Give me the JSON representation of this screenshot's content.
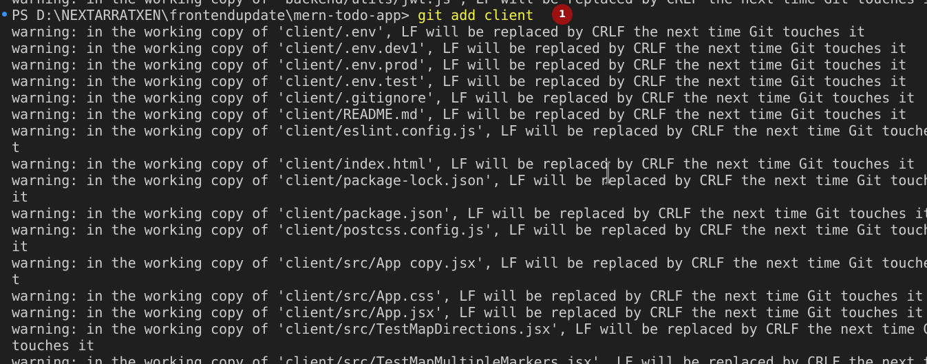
{
  "terminal": {
    "prompt": {
      "text": "PS D:\\NEXTARRATXEN\\frontendupdate\\mern-todo-app>",
      "command": "git add client"
    },
    "lines_before": [
      "warning: in the working copy of 'backend/utils/jwt.js', LF will be replaced by CRLF the next time Git touches it"
    ],
    "lines_after": [
      "warning: in the working copy of 'client/.env', LF will be replaced by CRLF the next time Git touches it",
      "warning: in the working copy of 'client/.env.dev1', LF will be replaced by CRLF the next time Git touches it",
      "warning: in the working copy of 'client/.env.prod', LF will be replaced by CRLF the next time Git touches it",
      "warning: in the working copy of 'client/.env.test', LF will be replaced by CRLF the next time Git touches it",
      "warning: in the working copy of 'client/.gitignore', LF will be replaced by CRLF the next time Git touches it",
      "warning: in the working copy of 'client/README.md', LF will be replaced by CRLF the next time Git touches it",
      "warning: in the working copy of 'client/eslint.config.js', LF will be replaced by CRLF the next time Git touches i",
      "t",
      "warning: in the working copy of 'client/index.html', LF will be replaced by CRLF the next time Git touches it",
      "warning: in the working copy of 'client/package-lock.json', LF will be replaced by CRLF the next time Git touches",
      "it",
      "warning: in the working copy of 'client/package.json', LF will be replaced by CRLF the next time Git touches it",
      "warning: in the working copy of 'client/postcss.config.js', LF will be replaced by CRLF the next time Git touches",
      "it",
      "warning: in the working copy of 'client/src/App copy.jsx', LF will be replaced by CRLF the next time Git touches i",
      "t",
      "warning: in the working copy of 'client/src/App.css', LF will be replaced by CRLF the next time Git touches it",
      "warning: in the working copy of 'client/src/App.jsx', LF will be replaced by CRLF the next time Git touches it",
      "warning: in the working copy of 'client/src/TestMapDirections.jsx', LF will be replaced by CRLF the next time Git",
      "touches it",
      "warning: in the working copy of 'client/src/TestMapMultipleMarkers.jsx', LF will be replaced by CRLF the next time"
    ],
    "annotation_badge": "1",
    "colors": {
      "background": "#1f1f1f",
      "text": "#cccccc",
      "command": "#f5f543",
      "badge": "#9b1111",
      "gutter_dot": "#3794ff"
    },
    "icons": {
      "gutter_marker": "command-decoration-dot",
      "cursor": "text-cursor-icon"
    }
  }
}
